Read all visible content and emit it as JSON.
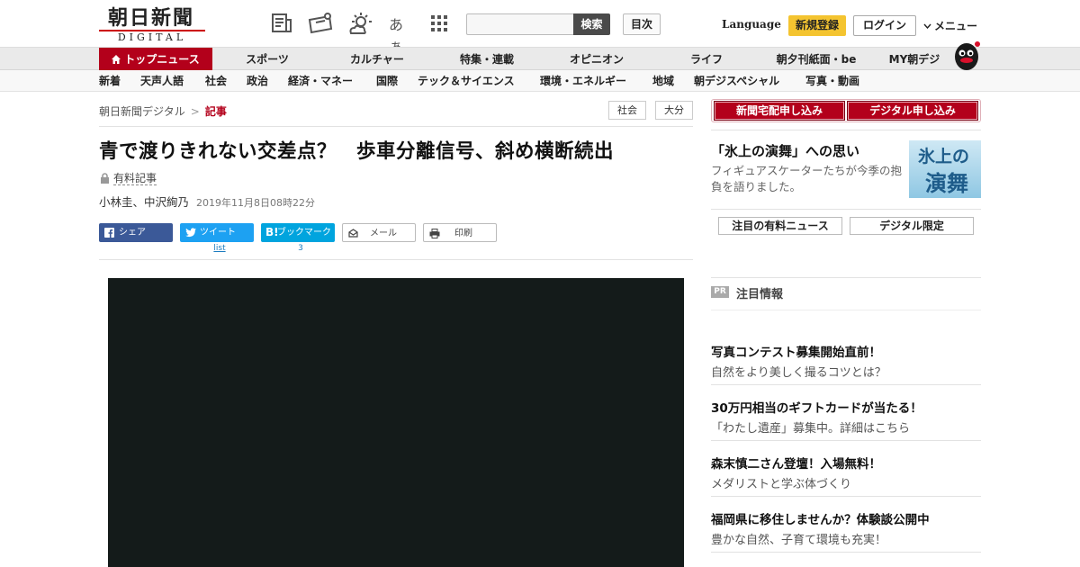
{
  "header": {
    "logo_top": "朝日新聞",
    "logo_bottom": "DIGITAL",
    "text_size_icon_label": "あぁ",
    "search_button": "検索",
    "toc_button": "目次",
    "language": "Language",
    "register": "新規登録",
    "login": "ログイン",
    "menu": "メニュー"
  },
  "nav_primary": [
    "トップニュース",
    "スポーツ",
    "カルチャー",
    "特集・連載",
    "オピニオン",
    "ライフ",
    "朝夕刊紙面・be",
    "MY朝デジ"
  ],
  "nav_secondary": [
    "新着",
    "天声人語",
    "社会",
    "政治",
    "経済・マネー",
    "国際",
    "テック＆サイエンス",
    "環境・エネルギー",
    "地域",
    "朝デジスペシャル",
    "写真・動画"
  ],
  "breadcrumb": {
    "home": "朝日新聞デジタル",
    "separator": ">",
    "current": "記事"
  },
  "tags": [
    "社会",
    "大分"
  ],
  "article": {
    "title": "青で渡りきれない交差点？　歩車分離信号、斜め横断続出",
    "paid_label": "有料記事",
    "authors": "小林圭、中沢絢乃",
    "date": "2019年11月8日08時22分"
  },
  "share": {
    "facebook": "シェア",
    "twitter": "ツイート",
    "twitter_count": "list",
    "hatena": "ブックマーク",
    "hatena_count": "3",
    "mail": "メール",
    "print": "印刷"
  },
  "sidebar": {
    "subscribe_paper": "新聞宅配申し込み",
    "subscribe_digital": "デジタル申し込み",
    "feature_title": "「氷上の演舞」への思い",
    "feature_desc": "フィギュアスケーターたちが今季の抱負を語りました。",
    "feature_image_text_1": "氷上の",
    "feature_image_text_2": "演舞",
    "btn_paid_news": "注目の有料ニュース",
    "btn_digital_only": "デジタル限定",
    "pr_badge": "PR",
    "pr_title": "注目情報",
    "promos": [
      {
        "headline": "写真コンテスト募集開始直前！",
        "sub": "自然をより美しく撮るコツとは？"
      },
      {
        "headline": "30万円相当のギフトカードが当たる！",
        "sub": "「わたし遺産」募集中。詳細はこちら"
      },
      {
        "headline": "森末慎二さん登壇！入場無料！",
        "sub": "メダリストと学ぶ体づくり"
      },
      {
        "headline": "福岡県に移住しませんか？体験談公開中",
        "sub": "豊かな自然、子育て環境も充実！"
      }
    ]
  },
  "colors": {
    "brand_red": "#b3001b",
    "register_yellow": "#f4c430",
    "facebook": "#3b5998",
    "twitter": "#1da1f2",
    "hatena": "#00a4de",
    "video_bg": "#141b1a"
  }
}
